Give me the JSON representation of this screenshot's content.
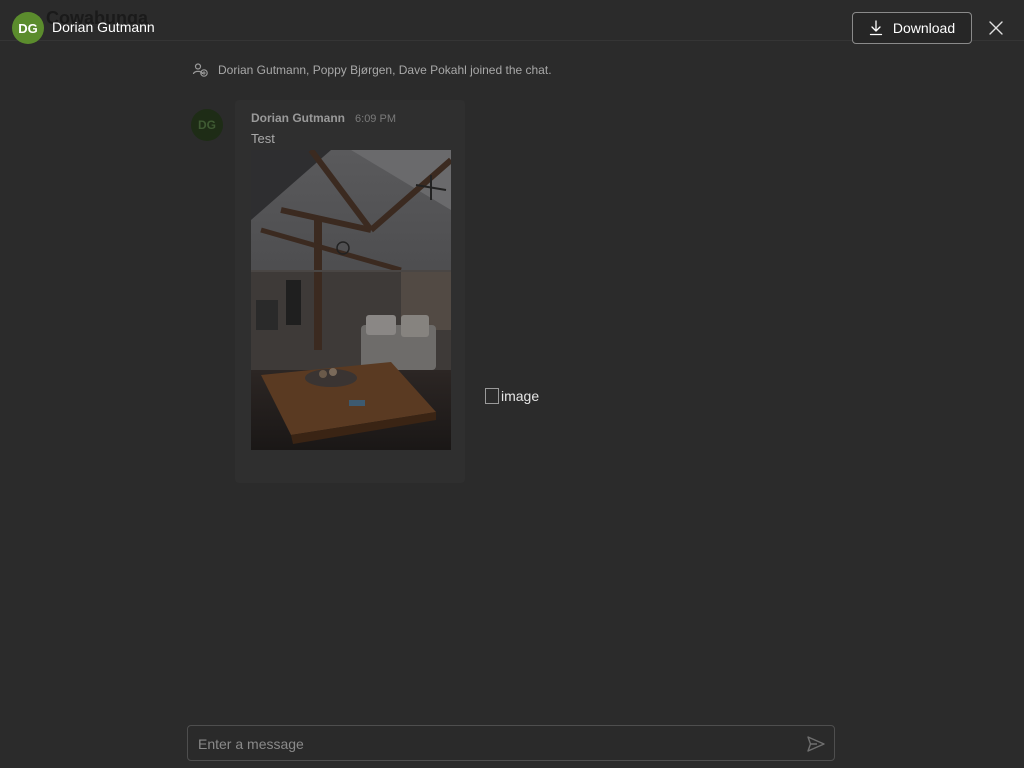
{
  "viewer": {
    "owner_initials": "DG",
    "owner_name": "Dorian Gutmann",
    "download_label": "Download",
    "close_icon": "close-icon",
    "download_icon": "download-icon"
  },
  "chat": {
    "title": "Cowabunga",
    "system_message": "Dorian Gutmann, Poppy Bjørgen, Dave Pokahl joined the chat.",
    "system_icon": "people-added-icon",
    "message": {
      "author_initials": "DG",
      "author": "Dorian Gutmann",
      "time": "6:09 PM",
      "text": "Test"
    },
    "broken_image_alt": "image",
    "composer_placeholder": "Enter a message",
    "send_icon": "send-icon"
  }
}
